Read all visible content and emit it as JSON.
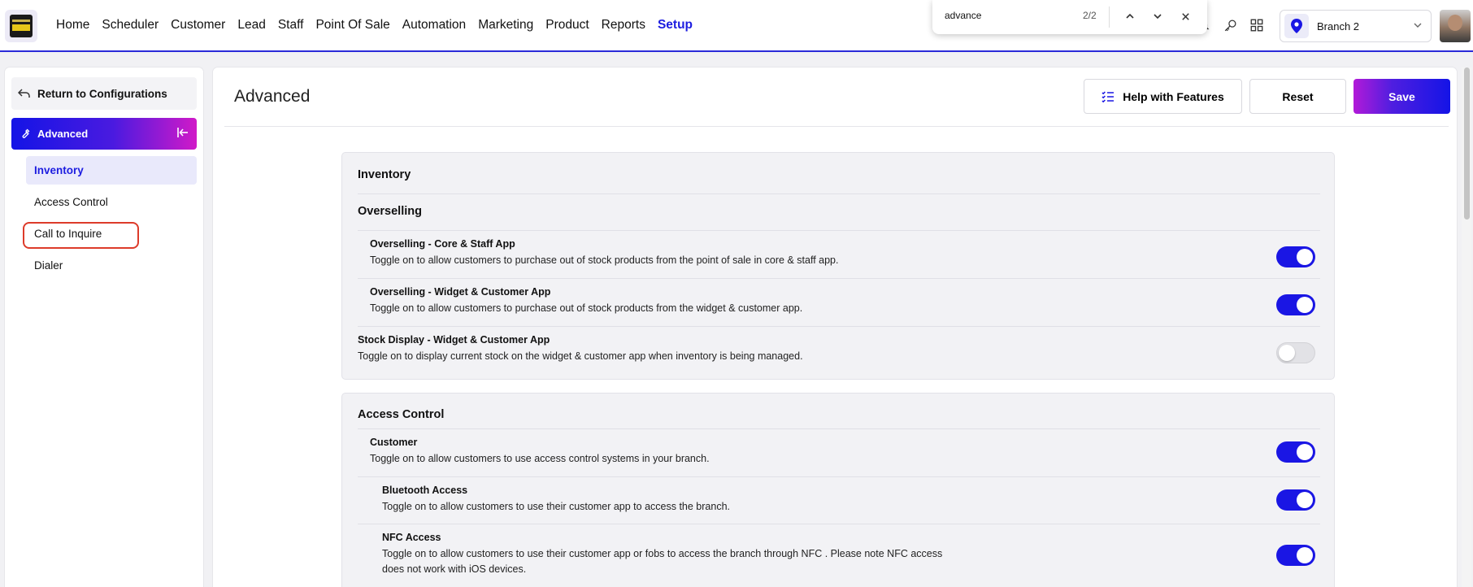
{
  "topbar": {
    "nav": [
      "Home",
      "Scheduler",
      "Customer",
      "Lead",
      "Staff",
      "Point Of Sale",
      "Automation",
      "Marketing",
      "Product",
      "Reports",
      "Setup"
    ],
    "active_nav": "Setup",
    "find": {
      "query": "advance",
      "count": "2/2"
    },
    "branch": "Branch 2"
  },
  "sidebar": {
    "return_label": "Return to Configurations",
    "section_label": "Advanced",
    "items": [
      "Inventory",
      "Access Control",
      "Call to Inquire",
      "Dialer"
    ],
    "active_item": "Inventory"
  },
  "main": {
    "title": "Advanced",
    "help_label": "Help with Features",
    "reset_label": "Reset",
    "save_label": "Save",
    "inventory": {
      "title": "Inventory",
      "subtitle": "Overselling",
      "rows": [
        {
          "title": "Overselling - Core & Staff App",
          "desc": "Toggle on to allow customers to purchase out of stock products from the point of sale in core & staff app.",
          "on": true
        },
        {
          "title": "Overselling - Widget & Customer App",
          "desc": "Toggle on to allow customers to purchase out of stock products from the widget & customer app.",
          "on": true
        },
        {
          "title": "Stock Display - Widget & Customer App",
          "desc": "Toggle on to display current stock on the widget & customer app when inventory is being managed.",
          "on": false
        }
      ]
    },
    "access_control": {
      "title": "Access Control",
      "rows": [
        {
          "title": "Customer",
          "desc": "Toggle on to allow customers to use access control systems in your branch.",
          "on": true
        },
        {
          "title": "Bluetooth Access",
          "desc": "Toggle on to allow customers to use their customer app to access the branch.",
          "on": true
        },
        {
          "title": "NFC Access",
          "desc": "Toggle on to allow customers to use their customer app or fobs to access the branch through NFC . Please note NFC access",
          "desc2": "does not work with iOS devices.",
          "on": true
        }
      ]
    }
  },
  "colors": {
    "accent": "#1a16e4",
    "highlight": "#dd3b2a"
  }
}
